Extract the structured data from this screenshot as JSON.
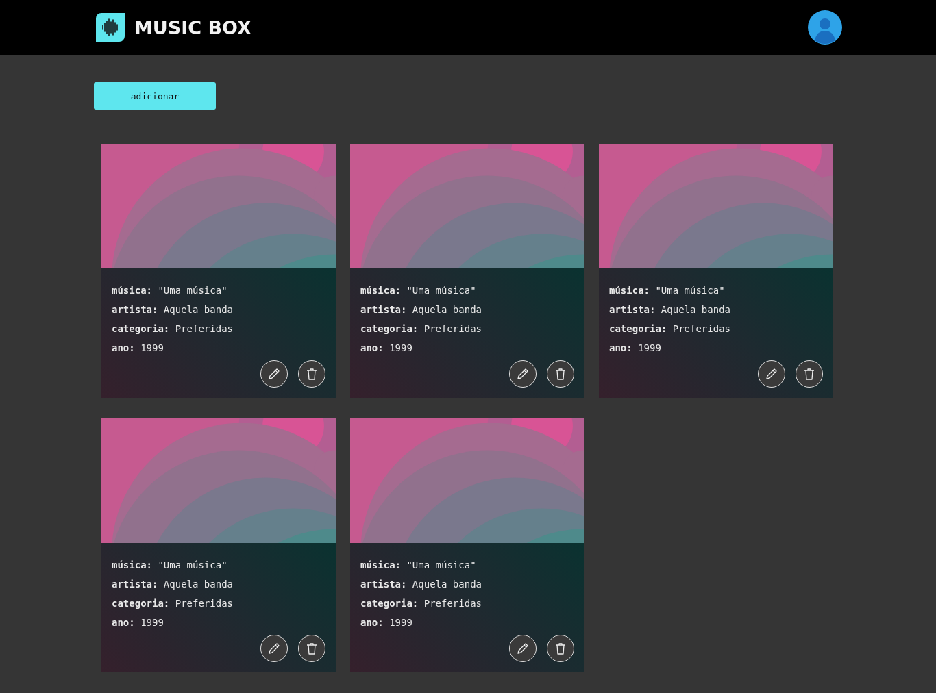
{
  "header": {
    "logo_text": "MUSIC BOX"
  },
  "add_button": {
    "label": "adicionar"
  },
  "cards": [
    {
      "kind": "picture",
      "fields": [
        "**música:** \"Uma música\"",
        "**artista:** Aquela banda",
        "**categoria:** Preferidas",
        "**ano:** 1999"
      ]
    },
    {
      "kind": "picture",
      "fields": [
        "**música:** \"Uma música\"",
        "**artista:** Aquela banda",
        "**categoria:** Preferidas",
        "**ano:** 1999"
      ]
    },
    {
      "kind": "picture",
      "fields": [
        "**música:** \"Uma música\"",
        "**artista:** Aquela banda",
        "**categoria:** Preferidas",
        "**ano:** 1999"
      ]
    },
    {
      "kind": "picture",
      "fields": [
        "**música:** \"Uma música\"",
        "**artista:** Aquela banda",
        "**categoria:** Preferidas",
        "**ano:** 1999"
      ]
    },
    {
      "kind": "picture",
      "fields": [
        "**música:** \"Uma música\"",
        "**artista:** Aquela banda",
        "**categoria:** Preferidas",
        "**ano:** 1999"
      ]
    }
  ]
}
